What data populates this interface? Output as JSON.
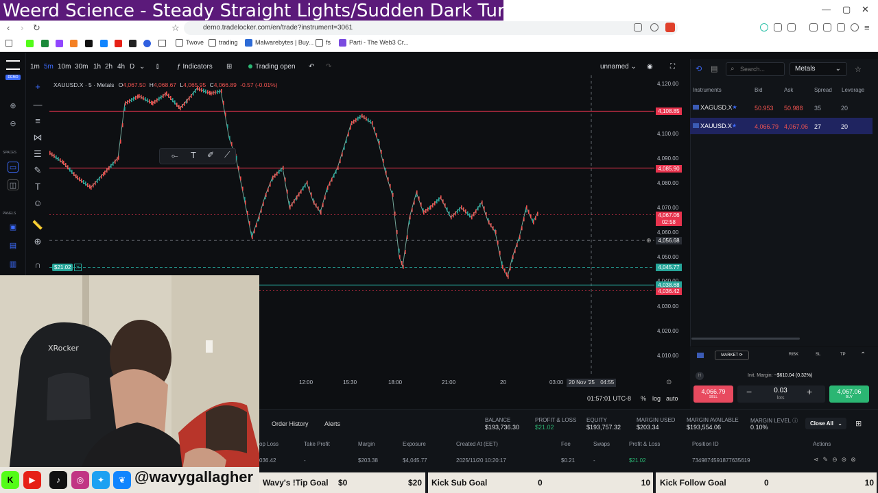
{
  "stream_title": "Weerd Science - Steady Straight Lights/Sudden Dark Turns",
  "browser": {
    "url": "demo.tradelocker.com/en/trade?instrument=3061",
    "bookmarks": [
      "Twove",
      "trading",
      "Malwarebytes | Buy...",
      "fs",
      "Parti - The Web3 Cr..."
    ]
  },
  "chart_toolbar": {
    "timeframes": [
      "1m",
      "5m",
      "10m",
      "30m",
      "1h",
      "2h",
      "4h",
      "D"
    ],
    "indicators": "Indicators",
    "trading_status": "Trading open",
    "layout_name": "unnamed"
  },
  "left_rail": {
    "brand": "DEMO",
    "spaces_label": "SPACES",
    "panels_label": "PANELS"
  },
  "chart": {
    "symbol_info": "XAUUSD.X · 5 · Metals",
    "ohlc": {
      "o_label": "O",
      "o": "4,067.50",
      "h_label": "H",
      "h": "4,068.67",
      "l_label": "L",
      "l": "4,065.95",
      "c_label": "C",
      "c": "4,066.89",
      "chg": "-0.57 (-0.01%)"
    },
    "pnl_badge": "$21.02",
    "price_ticks": [
      "4,120.00",
      "4,100.00",
      "4,090.00",
      "4,080.00",
      "4,070.00",
      "4,060.00",
      "4,050.00",
      "4,030.00",
      "4,020.00",
      "4,010.00"
    ],
    "price_tags": {
      "line1": "4,108.85",
      "line2": "4,085.90",
      "current": "4,067.06",
      "countdown": "02:58",
      "crosshair": "4,056.68",
      "entry": "4,045.77",
      "green_line": "4,038.68",
      "red_line": "4,036.42",
      "tick_4040": "4,040.00"
    },
    "time_ticks": [
      "12:00",
      "15:30",
      "18:00",
      "21:00",
      "20",
      "03:00"
    ],
    "crosshair_time": "20 Nov '25",
    "crosshair_time2": "04:55",
    "clock": "01:57:01 UTC-8",
    "scale_opts": [
      "%",
      "log",
      "auto"
    ]
  },
  "right_panel": {
    "search_placeholder": "Search...",
    "category": "Metals",
    "headers": [
      "Instruments",
      "Bid",
      "Ask",
      "Spread",
      "Leverage"
    ],
    "rows": [
      {
        "symbol": "XAGUSD.X",
        "bid": "50.953",
        "ask": "50.988",
        "spread": "35",
        "leverage": "20"
      },
      {
        "symbol": "XAUUSD.X",
        "bid": "4,066.79",
        "ask": "4,067.06",
        "spread": "27",
        "leverage": "20"
      }
    ]
  },
  "order_panel": {
    "tabs": [
      "MARKET",
      "RISK",
      "SL",
      "TP"
    ],
    "init_margin_label": "Init. Margin:",
    "init_margin": "~$610.04 (0.32%)",
    "sell_price": "4,066.79",
    "sell_label": "SELL",
    "lots": "0.03",
    "lots_label": "lots",
    "buy_price": "4,067.06",
    "buy_label": "BUY"
  },
  "bottom_panel": {
    "tabs": [
      "Order History",
      "Alerts"
    ],
    "stats": [
      {
        "label": "BALANCE",
        "value": "$193,736.30"
      },
      {
        "label": "PROFIT & LOSS",
        "value": "$21.02"
      },
      {
        "label": "EQUITY",
        "value": "$193,757.32"
      },
      {
        "label": "MARGIN USED",
        "value": "$203.34"
      },
      {
        "label": "MARGIN AVAILABLE",
        "value": "$193,554.06"
      },
      {
        "label": "MARGIN LEVEL",
        "value": "0.10%"
      }
    ],
    "close_all": "Close All",
    "columns": [
      "op Loss",
      "Take Profit",
      "Margin",
      "Exposure",
      "Created At (EET)",
      "Fee",
      "Swaps",
      "Profit & Loss",
      "Position ID",
      "Actions"
    ],
    "row": [
      "036.42",
      "-",
      "$203.38",
      "$4,045.77",
      "2025/11/20 10:20:17",
      "$0.21",
      "-",
      "$21.02",
      "7349874591877635619"
    ]
  },
  "overlay": {
    "handle": "@wavygallagher",
    "goals": [
      {
        "name": "Wavy's !Tip Goal",
        "current": "$0",
        "target": "$20"
      },
      {
        "name": "Kick Sub Goal",
        "current": "0",
        "target": "10"
      },
      {
        "name": "Kick Follow Goal",
        "current": "0",
        "target": "10"
      }
    ]
  },
  "colors": {
    "up": "#26a69a",
    "down": "#ef5350",
    "accent": "#3d6cff",
    "buy": "#2bb673",
    "sell": "#e84a5f",
    "stream_title_bg": "#5b1a7a"
  }
}
